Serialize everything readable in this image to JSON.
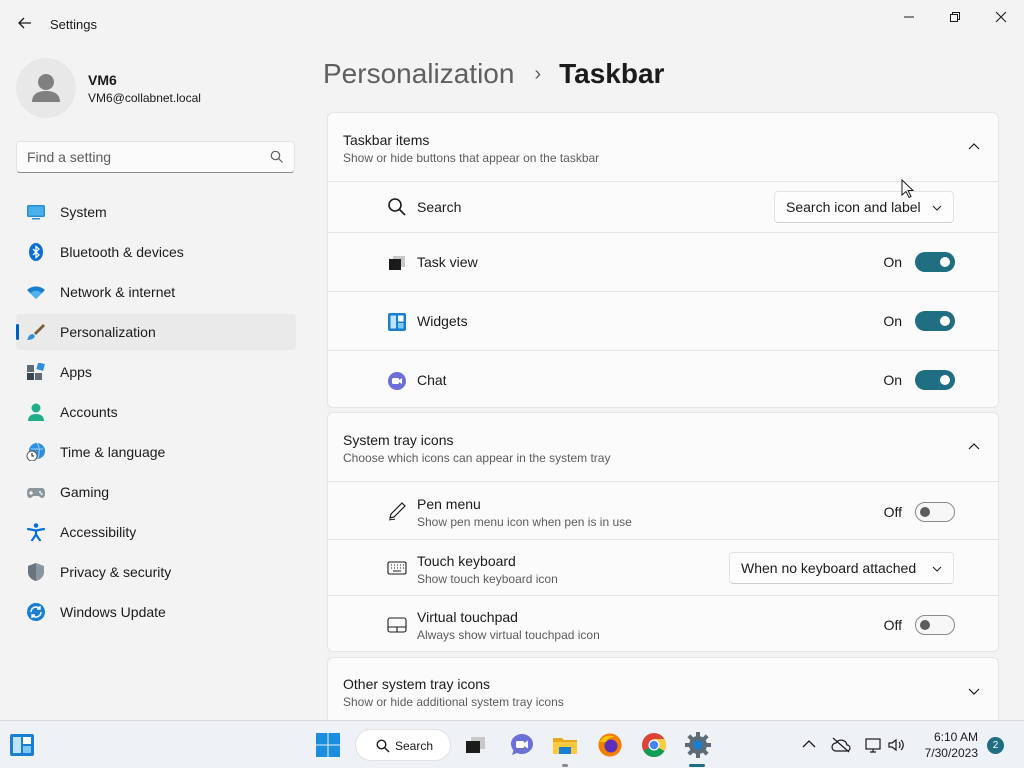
{
  "window": {
    "title": "Settings"
  },
  "user": {
    "name": "VM6",
    "email": "VM6@collabnet.local"
  },
  "search": {
    "placeholder": "Find a setting"
  },
  "sidebar": {
    "items": [
      {
        "label": "System",
        "icon": "system-icon"
      },
      {
        "label": "Bluetooth & devices",
        "icon": "bluetooth-icon"
      },
      {
        "label": "Network & internet",
        "icon": "wifi-icon"
      },
      {
        "label": "Personalization",
        "icon": "brush-icon",
        "selected": true
      },
      {
        "label": "Apps",
        "icon": "apps-icon"
      },
      {
        "label": "Accounts",
        "icon": "accounts-icon"
      },
      {
        "label": "Time & language",
        "icon": "globe-clock-icon"
      },
      {
        "label": "Gaming",
        "icon": "gamepad-icon"
      },
      {
        "label": "Accessibility",
        "icon": "accessibility-icon"
      },
      {
        "label": "Privacy & security",
        "icon": "shield-icon"
      },
      {
        "label": "Windows Update",
        "icon": "update-icon"
      }
    ]
  },
  "breadcrumb": {
    "parent": "Personalization",
    "separator": "›",
    "current": "Taskbar"
  },
  "sections": {
    "taskbar_items": {
      "title": "Taskbar items",
      "subtitle": "Show or hide buttons that appear on the taskbar",
      "rows": {
        "search": {
          "label": "Search",
          "value": "Search icon and label"
        },
        "task_view": {
          "label": "Task view",
          "state": "On"
        },
        "widgets": {
          "label": "Widgets",
          "state": "On"
        },
        "chat": {
          "label": "Chat",
          "state": "On"
        }
      }
    },
    "system_tray": {
      "title": "System tray icons",
      "subtitle": "Choose which icons can appear in the system tray",
      "rows": {
        "pen_menu": {
          "label": "Pen menu",
          "sub": "Show pen menu icon when pen is in use",
          "state": "Off"
        },
        "touch_keyboard": {
          "label": "Touch keyboard",
          "sub": "Show touch keyboard icon",
          "value": "When no keyboard attached"
        },
        "virtual_touchpad": {
          "label": "Virtual touchpad",
          "sub": "Always show virtual touchpad icon",
          "state": "Off"
        }
      }
    },
    "other_tray": {
      "title": "Other system tray icons",
      "subtitle": "Show or hide additional system tray icons"
    }
  },
  "taskbar": {
    "search_label": "Search",
    "time": "6:10 AM",
    "date": "7/30/2023",
    "notifications": "2"
  },
  "colors": {
    "accent": "#1f6e82",
    "selection_bar": "#005fb8"
  }
}
